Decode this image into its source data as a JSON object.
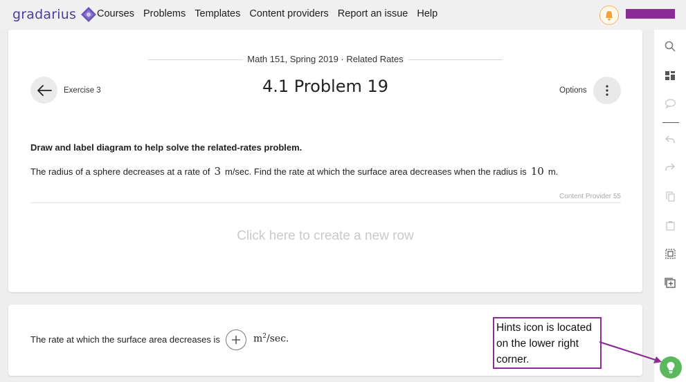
{
  "app": {
    "logo_text": "gradarius",
    "nav": [
      "Courses",
      "Problems",
      "Templates",
      "Content providers",
      "Report an issue",
      "Help"
    ]
  },
  "header": {
    "breadcrumb": "Math 151, Spring 2019 · Related Rates",
    "exercise_label": "Exercise 3",
    "title": "4.1 Problem 19",
    "options_label": "Options"
  },
  "problem": {
    "instruction": "Draw and label diagram to help solve the related-rates problem.",
    "statement_part1": "The radius of a sphere decreases at a rate of",
    "rate_value": "3",
    "statement_part2": "m/sec. Find the rate at which the surface area decreases when the radius is",
    "radius_value": "10",
    "statement_part3": "m.",
    "provider": "Content Provider 55",
    "new_row_prompt": "Click here to create a new row"
  },
  "answer": {
    "prompt": "The rate at which the surface area decreases is",
    "unit_base": "m",
    "unit_exp": "2",
    "unit_rest": "/sec."
  },
  "annotation": {
    "text": "Hints icon is located on the lower right corner."
  },
  "sidebar": {
    "icons": [
      "search-icon",
      "layout-icon",
      "comment-icon",
      "undo-icon",
      "redo-icon",
      "copy-icon",
      "paste-icon",
      "select-all-icon",
      "add-box-icon"
    ]
  },
  "colors": {
    "brand": "#4d3c9b",
    "accent_purple": "#8b2c96",
    "hint_green": "#5cb85c",
    "bell": "#f2a33a"
  }
}
